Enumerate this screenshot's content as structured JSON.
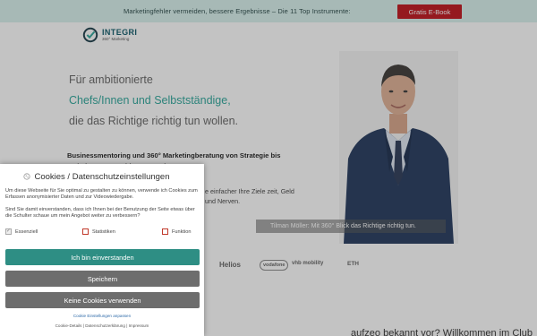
{
  "topbar": {
    "text": "Marketingfehler vermeiden, bessere Ergebnisse – Die 11 Top Instrumente:",
    "button": "Gratis E-Book"
  },
  "logo": {
    "name": "INTEGRI",
    "tagline": "360° Marketing"
  },
  "hero": {
    "line1": "Für ambitionierte",
    "line2": "Chefs/Innen und Selbstständige,",
    "line3": "die das Richtige richtig tun wollen.",
    "bold": "Businessmentoring und 360° Marketingberatung von Strategie bis Website, 1:1 Coaching, Know-how, Kurse,",
    "text": "e einfacher Ihre Ziele zeit, Geld und Nerven."
  },
  "photo": {
    "caption": "Tilman Möller: Mit 360° Blick das Richtige richtig tun."
  },
  "partners": [
    "Helios",
    "vodafone",
    "vhb mobility",
    "ETH"
  ],
  "bottom": {
    "heading": "aufzeo bekannt vor? Willkommen im Club"
  },
  "cookie": {
    "title": "Cookies / Datenschutzeinstellungen",
    "p1": "Um diese Webseite für Sie optimal zu gestalten zu können, verwende ich Cookies zum Erfassen anonymisierter Daten und zur Videowiedergabe.",
    "p2": "Sind Sie damit einverstanden, dass ich Ihnen bei der Benutzung der Seite etwas über die Schulter schaue um mein Angebot weiter zu verbessern?",
    "checkboxes": [
      {
        "label": "Essenziell",
        "checked": true
      },
      {
        "label": "Statistiken",
        "checked": false
      },
      {
        "label": "Funktion",
        "checked": false
      }
    ],
    "accept": "Ich bin einverstanden",
    "save": "Speichern",
    "none": "Keine Cookies verwenden",
    "settings_link": "Cookie Einstellungen anpassen",
    "footer": "Cookie-Details | Datenschutzerklärung | Impressum"
  },
  "colors": {
    "accent": "#2e8e84",
    "promo_red": "#c0141d",
    "topbar_bg": "#d9f1ee"
  }
}
